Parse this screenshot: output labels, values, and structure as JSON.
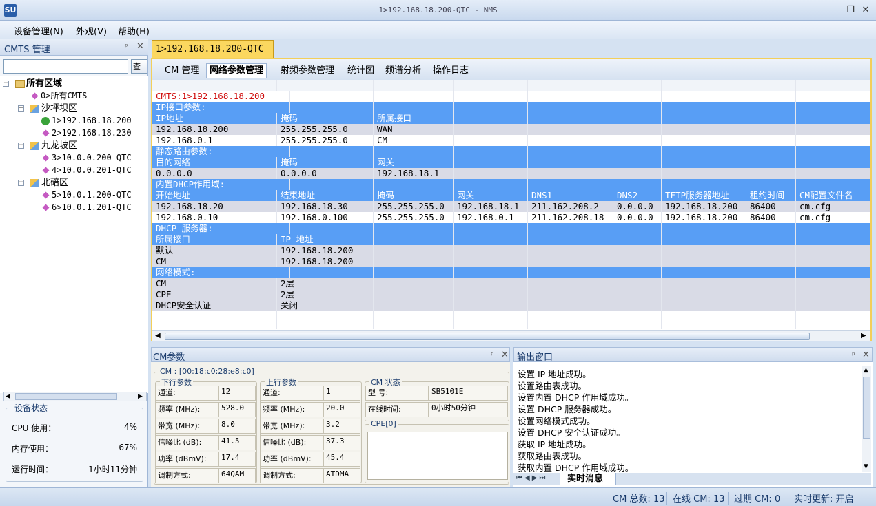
{
  "window": {
    "title": "1>192.168.18.200-QTC - NMS",
    "app_icon": "SU",
    "min": "–",
    "restore": "❐",
    "close": "✕"
  },
  "menu": [
    "设备管理(N)",
    "外观(V)",
    "帮助(H)"
  ],
  "left": {
    "title": "CMTS 管理",
    "search_button": "查找",
    "tree": [
      {
        "label": "所有区域",
        "level": 0,
        "icon": "root"
      },
      {
        "label": "0>所有CMTS",
        "level": 1,
        "icon": "gem"
      },
      {
        "label": "沙坪坝区",
        "level": 1,
        "icon": "area"
      },
      {
        "label": "1>192.168.18.200",
        "level": 2,
        "icon": "ok"
      },
      {
        "label": "2>192.168.18.230",
        "level": 2,
        "icon": "gem"
      },
      {
        "label": "九龙坡区",
        "level": 1,
        "icon": "area"
      },
      {
        "label": "3>10.0.0.200-QTC",
        "level": 2,
        "icon": "gem"
      },
      {
        "label": "4>10.0.0.201-QTC",
        "level": 2,
        "icon": "gem"
      },
      {
        "label": "北碚区",
        "level": 1,
        "icon": "area"
      },
      {
        "label": "5>10.0.1.200-QTC",
        "level": 2,
        "icon": "gem"
      },
      {
        "label": "6>10.0.1.201-QTC",
        "level": 2,
        "icon": "gem"
      }
    ],
    "device_status": {
      "title": "设备状态",
      "cpu_label": "CPU 使用：",
      "cpu": "4%",
      "mem_label": "内存使用：",
      "mem": "67%",
      "up_label": "运行时间：",
      "up": "1小时11分钟"
    }
  },
  "doc_tab": "1>192.168.18.200-QTC",
  "sub_tabs": [
    "CM 管理",
    "网络参数管理",
    "射频参数管理",
    "统计图",
    "频谱分析",
    "操作日志"
  ],
  "active_sub_tab": 1,
  "grid": {
    "rows": [
      {
        "style": "head",
        "cells": []
      },
      {
        "style": "white",
        "red": true,
        "cells": [
          "CMTS:1>192.168.18.200"
        ]
      },
      {
        "style": "blue",
        "cells": [
          "IP接口参数:"
        ]
      },
      {
        "style": "blue",
        "cells": [
          "IP地址",
          "掩码",
          "所属接口"
        ]
      },
      {
        "style": "gray",
        "cells": [
          "192.168.18.200",
          "255.255.255.0",
          "WAN"
        ]
      },
      {
        "style": "white",
        "cells": [
          "192.168.0.1",
          "255.255.255.0",
          "CM"
        ]
      },
      {
        "style": "blue",
        "cells": [
          "静态路由参数:"
        ]
      },
      {
        "style": "blue",
        "cells": [
          "目的网络",
          "掩码",
          "网关"
        ]
      },
      {
        "style": "gray",
        "cells": [
          "0.0.0.0",
          "0.0.0.0",
          "192.168.18.1"
        ]
      },
      {
        "style": "blue",
        "cells": [
          "内置DHCP作用域:"
        ]
      },
      {
        "style": "blue",
        "cells": [
          "开始地址",
          "结束地址",
          "掩码",
          "网关",
          "DNS1",
          "DNS2",
          "TFTP服务器地址",
          "租约时间",
          "CM配置文件名"
        ]
      },
      {
        "style": "gray",
        "cells": [
          "192.168.18.20",
          "192.168.18.30",
          "255.255.255.0",
          "192.168.18.1",
          "211.162.208.2",
          "0.0.0.0",
          "192.168.18.200",
          "86400",
          "cm.cfg"
        ]
      },
      {
        "style": "white",
        "cells": [
          "192.168.0.10",
          "192.168.0.100",
          "255.255.255.0",
          "192.168.0.1",
          "211.162.208.18",
          "0.0.0.0",
          "192.168.18.200",
          "86400",
          "cm.cfg"
        ]
      },
      {
        "style": "blue",
        "cells": [
          "DHCP 服务器:"
        ]
      },
      {
        "style": "blue",
        "cells": [
          "所属接口",
          "IP 地址"
        ]
      },
      {
        "style": "gray",
        "cells": [
          "默认",
          "192.168.18.200"
        ]
      },
      {
        "style": "gray",
        "cells": [
          "CM",
          "192.168.18.200"
        ]
      },
      {
        "style": "blue",
        "cells": [
          "网络模式:"
        ]
      },
      {
        "style": "gray",
        "cells": [
          "CM",
          "2层"
        ]
      },
      {
        "style": "gray",
        "cells": [
          "CPE",
          "2层"
        ]
      },
      {
        "style": "gray",
        "cells": [
          "DHCP安全认证",
          "关闭"
        ]
      },
      {
        "style": "white",
        "cells": []
      },
      {
        "style": "white",
        "cells": []
      }
    ]
  },
  "cm_panel": {
    "title": "CM参数",
    "cm_mac": "CM : [00:18:c0:28:e8:c0]",
    "down": {
      "title": "下行参数",
      "fields": [
        [
          "通道:",
          "12"
        ],
        [
          "频率 (MHz):",
          "528.0"
        ],
        [
          "带宽 (MHz):",
          "8.0"
        ],
        [
          "信噪比 (dB):",
          "41.5"
        ],
        [
          "功率 (dBmV):",
          "17.4"
        ],
        [
          "调制方式:",
          "64QAM"
        ]
      ]
    },
    "up": {
      "title": "上行参数",
      "fields": [
        [
          "通道:",
          "1"
        ],
        [
          "频率 (MHz):",
          "20.0"
        ],
        [
          "带宽 (MHz):",
          "3.2"
        ],
        [
          "信噪比 (dB):",
          "37.3"
        ],
        [
          "功率 (dBmV):",
          "45.4"
        ],
        [
          "调制方式:",
          "ATDMA"
        ]
      ]
    },
    "status": {
      "title": "CM 状态",
      "fields": [
        [
          "型  号:",
          "SB5101E"
        ],
        [
          "在线时间:",
          "0小时50分钟"
        ]
      ]
    },
    "cpe_title": "CPE[0]"
  },
  "output": {
    "title": "输出窗口",
    "lines": [
      "设置 IP 地址成功。",
      "设置路由表成功。",
      "设置内置 DHCP 作用域成功。",
      "设置 DHCP 服务器成功。",
      "设置网络模式成功。",
      "设置 DHCP 安全认证成功。",
      "获取 IP 地址成功。",
      "获取路由表成功。",
      "获取内置 DHCP 作用域成功。"
    ],
    "tab": "实时消息"
  },
  "status_bar": {
    "cm_total": "CM 总数: 13",
    "cm_online": "在线 CM: 13",
    "cm_expired": "过期 CM: 0",
    "realtime": "实时更新: 开启"
  },
  "colors": {
    "accent_tab": "#fbd75f",
    "row_blue": "#589ef5",
    "row_gray": "#d9dbe6",
    "cmts_red": "#d01010"
  }
}
